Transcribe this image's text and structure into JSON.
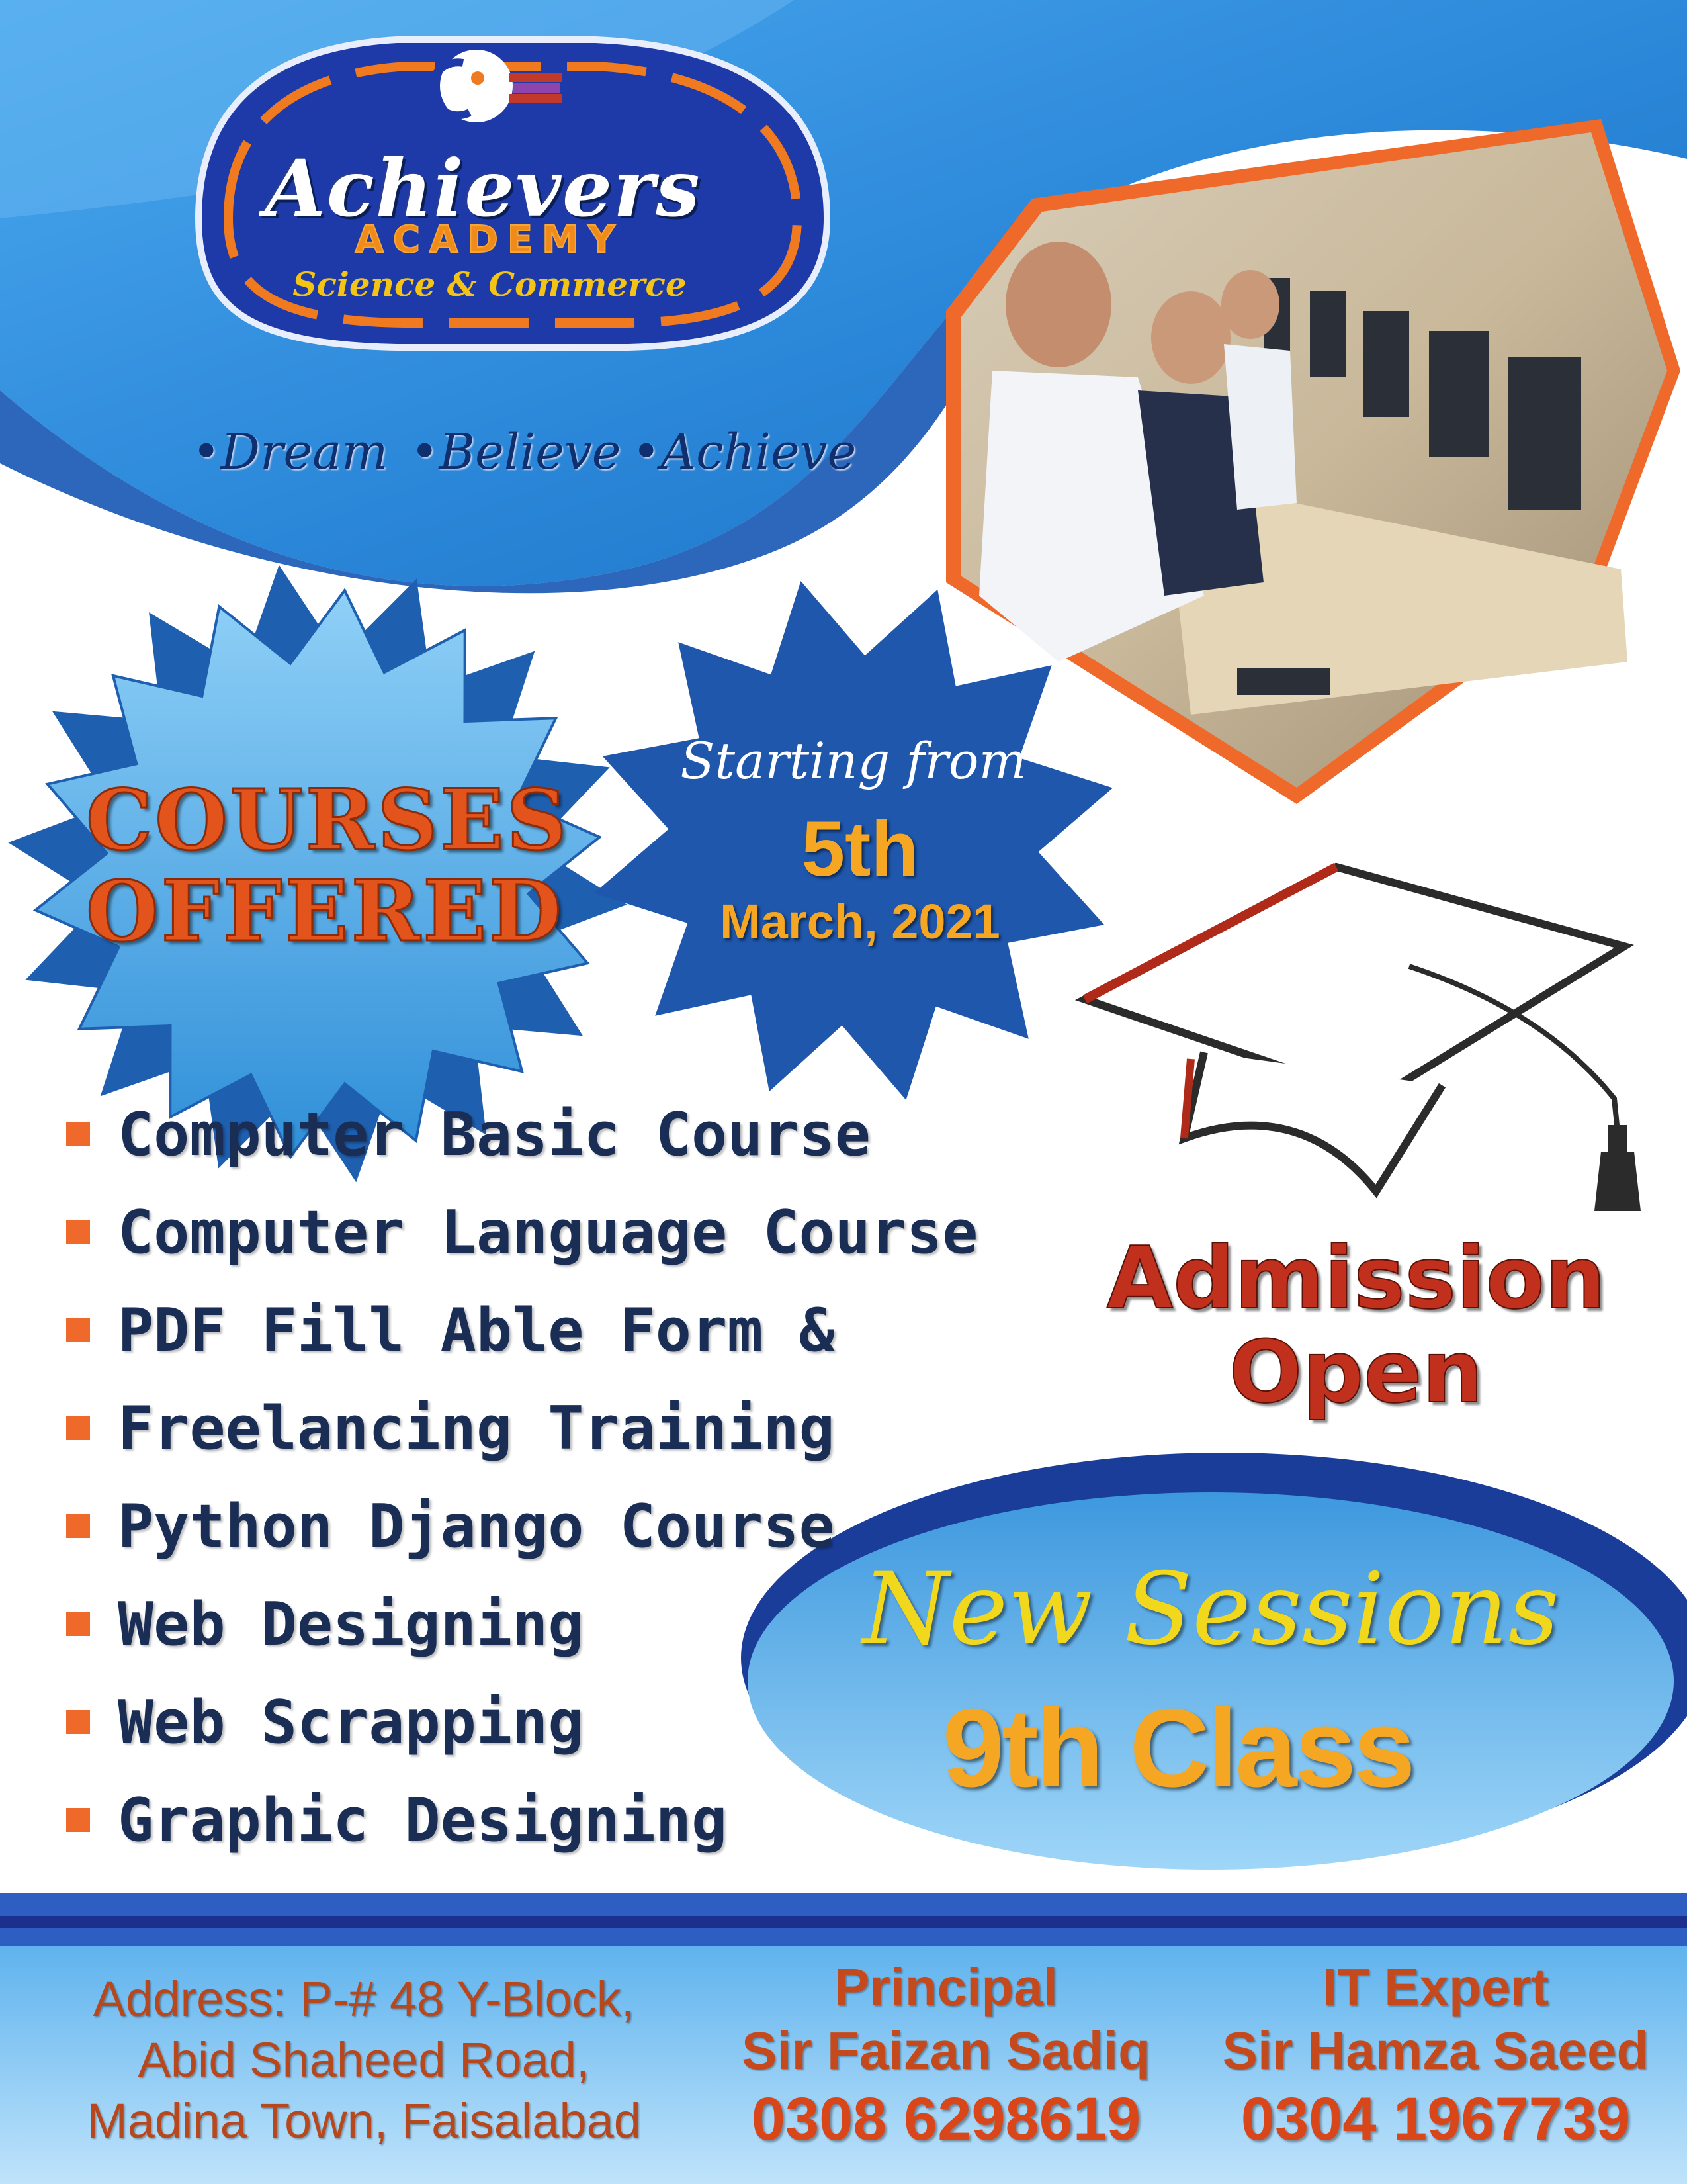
{
  "brand": {
    "name": "Achievers",
    "academy": "ACADEMY",
    "subtitle": "Science & Commerce"
  },
  "tagline": [
    "•Dream",
    "•Believe",
    "•Achieve"
  ],
  "courses": {
    "heading_line1": "COURSES",
    "heading_line2": "OFFERED",
    "items": [
      "Computer Basic Course",
      "Computer Language Course",
      "PDF Fill Able Form &",
      "Freelancing Training",
      "Python Django Course",
      "Web Designing",
      "Web Scrapping",
      "Graphic Designing"
    ]
  },
  "start": {
    "label": "Starting from",
    "day": "5th",
    "month_year": "March, 2021"
  },
  "admission": {
    "line1": "Admission",
    "line2": "Open"
  },
  "sessions": {
    "title": "New Sessions",
    "class": "9th Class"
  },
  "footer": {
    "address_line1": "Address: P-# 48 Y-Block,",
    "address_line2": "Abid Shaheed Road,",
    "address_line3": "Madina Town, Faisalabad",
    "principal_role": "Principal",
    "principal_name": "Sir Faizan Sadiq",
    "principal_phone": "0308 6298619",
    "it_role": "IT Expert",
    "it_name": "Sir Hamza Saeed",
    "it_phone": "0304 1967739"
  },
  "colors": {
    "primary_blue": "#1d6fc4",
    "navy": "#1b2f8a",
    "orange": "#ef6a2a",
    "gold": "#f5a623"
  }
}
